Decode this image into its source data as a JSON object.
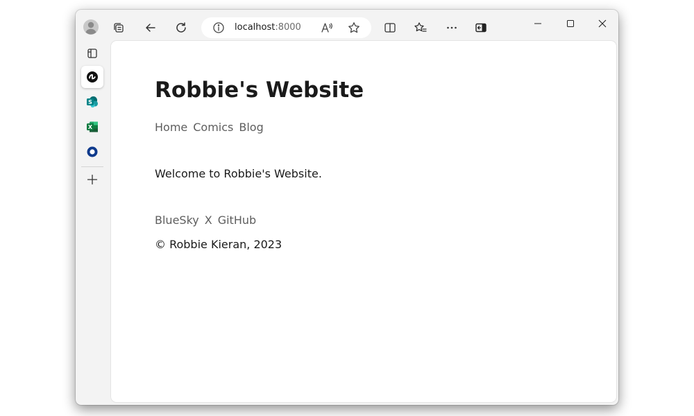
{
  "browser": {
    "address_bar": {
      "host": "localhost",
      "port": ":8000"
    },
    "toolbar_icons": [
      "profile-icon",
      "workspaces-icon",
      "back-icon",
      "refresh-icon",
      "site-info-icon",
      "read-aloud-icon",
      "favorite-star-icon",
      "split-screen-icon",
      "favorites-icon",
      "more-icon",
      "sidebar-toggle-icon"
    ],
    "window_controls": [
      "minimize-icon",
      "maximize-icon",
      "close-icon"
    ],
    "sidebar_icons": [
      "tab-actions-icon",
      "copilot-icon",
      "sharepoint-icon",
      "excel-icon",
      "outlook-icon",
      "add-icon"
    ]
  },
  "page": {
    "title": "Robbie's Website",
    "nav": [
      "Home",
      "Comics",
      "Blog"
    ],
    "welcome": "Welcome to Robbie's Website.",
    "social": [
      "BlueSky",
      "X",
      "GitHub"
    ],
    "copyright": "© Robbie Kieran, 2023"
  },
  "colors": {
    "chrome_bg": "#f3f3f3",
    "page_bg": "#ffffff",
    "heading_text": "#1a1a1a",
    "link_text": "#5e5e5e",
    "sharepoint": "#038387",
    "excel": "#107c41",
    "outlook": "#0f3a8c"
  }
}
